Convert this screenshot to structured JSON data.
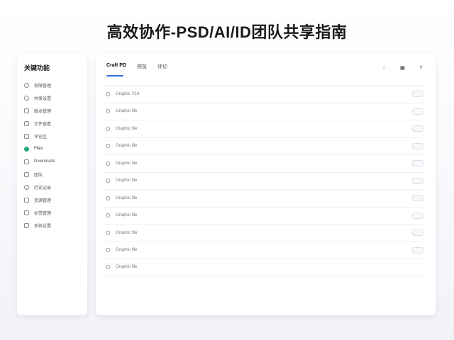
{
  "page": {
    "title": "高效协作-PSD/AI/ID团队共享指南"
  },
  "sidebar": {
    "title": "关键功能",
    "items": [
      {
        "label": "权限管理",
        "icon": "circle-icon"
      },
      {
        "label": "共享设置",
        "icon": "circle-icon"
      },
      {
        "label": "版本管理",
        "icon": "layers-icon"
      },
      {
        "label": "文件查看",
        "icon": "file-icon"
      },
      {
        "label": "评论区",
        "icon": "comment-icon"
      },
      {
        "label": "Files",
        "icon": "status-dot-icon",
        "active": true
      },
      {
        "label": "Downloads",
        "icon": "image-icon"
      },
      {
        "label": "团队",
        "icon": "folder-icon"
      },
      {
        "label": "历史记录",
        "icon": "clock-icon"
      },
      {
        "label": "资源管理",
        "icon": "box-icon"
      },
      {
        "label": "标签管理",
        "icon": "tag-icon"
      },
      {
        "label": "系统设置",
        "icon": "gear-icon"
      }
    ]
  },
  "main": {
    "tabs": [
      {
        "label": "Craft PD",
        "active": true
      },
      {
        "label": "预览"
      },
      {
        "label": "评论"
      }
    ],
    "toolbar": [
      {
        "name": "bell-icon",
        "glyph": "♢"
      },
      {
        "name": "print-icon",
        "glyph": "▣"
      },
      {
        "name": "share-icon",
        "glyph": "⇪"
      }
    ],
    "rows": [
      {
        "label": "Graphic V10",
        "has_action": true
      },
      {
        "label": "Graphic file",
        "has_action": true
      },
      {
        "label": "Graphic file",
        "has_action": true
      },
      {
        "label": "Graphic file",
        "has_action": true
      },
      {
        "label": "Graphic file",
        "has_action": true
      },
      {
        "label": "Graphic file",
        "has_action": true
      },
      {
        "label": "Graphic file",
        "has_action": true
      },
      {
        "label": "Graphic file",
        "has_action": true
      },
      {
        "label": "Graphic file",
        "has_action": true
      },
      {
        "label": "Graphic file",
        "has_action": true
      },
      {
        "label": "Graphic file",
        "has_action": false
      }
    ]
  },
  "colors": {
    "accent": "#2f6fe0",
    "active_dot": "#1fa67a",
    "background": "#f5f6fa"
  }
}
